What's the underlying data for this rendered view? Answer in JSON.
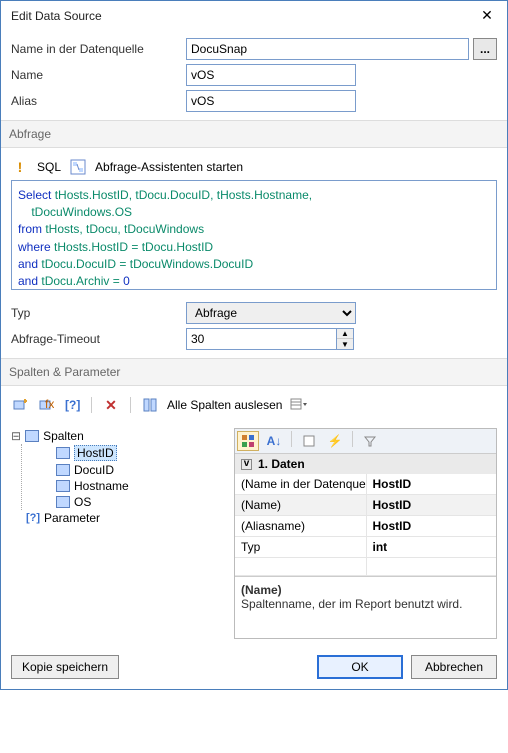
{
  "titlebar": {
    "title": "Edit Data Source"
  },
  "fields": {
    "name_in_ds_label": "Name in der Datenquelle",
    "name_in_ds_value": "DocuSnap",
    "name_label": "Name",
    "name_value": "vOS",
    "alias_label": "Alias",
    "alias_value": "vOS"
  },
  "sections": {
    "abfrage": "Abfrage",
    "spalten": "Spalten & Parameter"
  },
  "abfrage_toolbar": {
    "sql_label": "SQL",
    "wizard_label": "Abfrage-Assistenten starten"
  },
  "sql": {
    "line1_kw": "Select ",
    "line1_rest": "tHosts.HostID, tDocu.DocuID, tHosts.Hostname,",
    "line1b_rest": "    tDocuWindows.OS",
    "line2_kw": "from ",
    "line2_rest": "tHosts, tDocu, tDocuWindows",
    "line3_kw": "where ",
    "line3_rest": "tHosts.HostID = tDocu.HostID",
    "line4_kw": "and ",
    "line4_rest": "tDocu.DocuID = tDocuWindows.DocuID",
    "line5_kw": "and ",
    "line5_rest": "tDocu.Archiv = ",
    "line5_num": "0"
  },
  "typ": {
    "label": "Typ",
    "value": "Abfrage"
  },
  "timeout": {
    "label": "Abfrage-Timeout",
    "value": "30"
  },
  "cols_toolbar": {
    "readall": "Alle Spalten auslesen"
  },
  "tree": {
    "spalten": "Spalten",
    "hostid": "HostID",
    "docuid": "DocuID",
    "hostname": "Hostname",
    "os": "OS",
    "parameter": "Parameter"
  },
  "propgrid": {
    "cat": "1. Daten",
    "r1k": "(Name in der Datenquelle)",
    "r1v": "HostID",
    "r2k": "(Name)",
    "r2v": "HostID",
    "r3k": "(Aliasname)",
    "r3v": "HostID",
    "r4k": "Typ",
    "r4v": "int",
    "desc_title": "(Name)",
    "desc_text": "Spaltenname, der im Report benutzt wird."
  },
  "footer": {
    "save_copy": "Kopie speichern",
    "ok": "OK",
    "cancel": "Abbrechen"
  }
}
